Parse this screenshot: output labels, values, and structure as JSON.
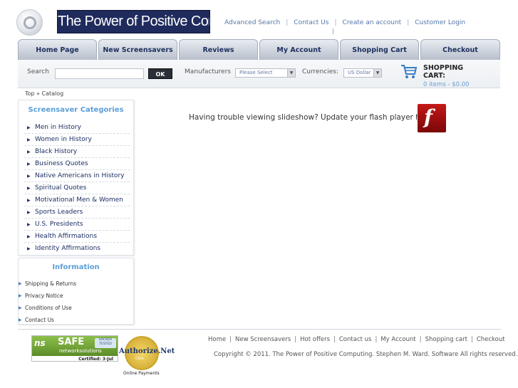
{
  "header": {
    "logo_text": "The Power of Positive Computing",
    "links": [
      "Advanced Search",
      "Contact Us",
      "Create an account",
      "Customer Login"
    ]
  },
  "nav": {
    "tabs": [
      "Home Page",
      "New Screensavers",
      "Reviews",
      "My Account",
      "Shopping Cart",
      "Checkout"
    ]
  },
  "searchbar": {
    "search_label": "Search",
    "search_value": "",
    "ok_label": "OK",
    "manufacturers_label": "Manufacturers",
    "manufacturers_selected": "Please Select",
    "currencies_label": "Currencies:",
    "currency_selected": "US Dollar",
    "cart_title": "SHOPPING CART:",
    "cart_items": "0 items - $0.00"
  },
  "breadcrumb": {
    "top": "Top",
    "separator": "»",
    "current": "Catalog"
  },
  "sidebar": {
    "categories_title": "Screensaver Categories",
    "categories": [
      "Men in History",
      "Women in History",
      "Black History",
      "Business Quotes",
      "Native Americans in History",
      "Spiritual Quotes",
      "Motivational Men & Women",
      "Sports Leaders",
      "U.S. Presidents",
      "Health Affirmations",
      "Identity Affirmations"
    ],
    "info_title": "Information",
    "info_links": [
      "Shipping & Returns",
      "Privacy Notice",
      "Conditions of Use",
      "Contact Us"
    ]
  },
  "main": {
    "flash_message": "Having trouble viewing slideshow? Update your flash player here."
  },
  "footer": {
    "links": [
      "Home",
      "New Screensavers",
      "Hot offers",
      "Contact us",
      "My Account",
      "Shopping cart",
      "Checkout"
    ],
    "copyright": "Copyright © 2011. The Power of Positive Computing. Stephen M. Ward. Software All rights reserved.",
    "ns_logo": "ns",
    "ns_safe": "SAFE",
    "ns_hacker": "HACKER TESTED",
    "ns_sub": "networksolutions",
    "ns_cert": "Certified: 3-Jul",
    "auth_name": "Authorize.Net",
    "auth_click": "Click",
    "auth_sub": "Online Payments"
  },
  "colors": {
    "logo_bg": "#1f2b5c",
    "link": "#5577aa",
    "category_title": "#5c9fd8",
    "flash_red": "#c41818"
  }
}
